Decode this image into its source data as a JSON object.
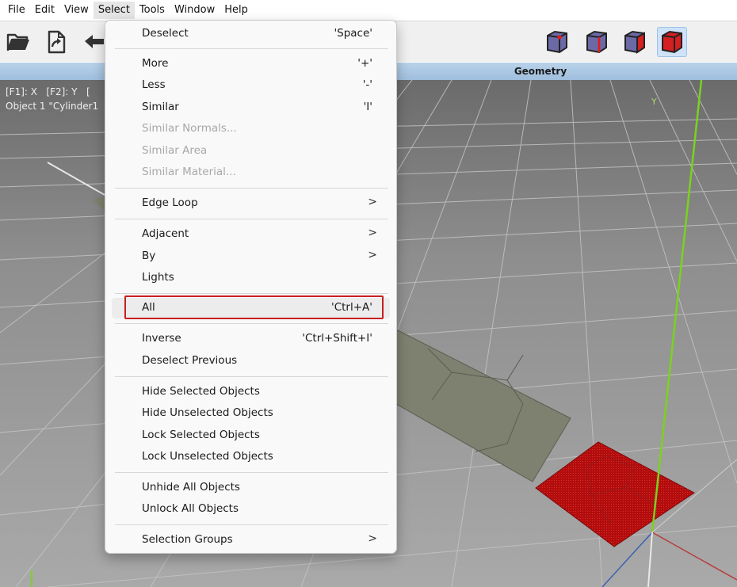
{
  "menubar": {
    "items": [
      {
        "label": "File"
      },
      {
        "label": "Edit"
      },
      {
        "label": "View"
      },
      {
        "label": "Select",
        "active": true
      },
      {
        "label": "Tools"
      },
      {
        "label": "Window"
      },
      {
        "label": "Help"
      }
    ]
  },
  "toolbar": {
    "left_icons": [
      "open-folder-icon",
      "import-file-icon",
      "undo-arrow-icon"
    ],
    "mode_icons": [
      "vertex-select-mode-icon",
      "edge-select-mode-icon",
      "face-select-mode-icon",
      "body-select-mode-icon"
    ],
    "active_mode": "body-select-mode-icon"
  },
  "geometry_bar": {
    "title": "Geometry"
  },
  "viewport": {
    "info_line1": "[F1]: X   [F2]: Y   [",
    "info_line2": "Object 1 \"Cylinder1",
    "axis_label_y": "Y"
  },
  "select_menu": {
    "deselect": {
      "label": "Deselect",
      "shortcut": "'Space'"
    },
    "more": {
      "label": "More",
      "shortcut": "'+'"
    },
    "less": {
      "label": "Less",
      "shortcut": "'-'"
    },
    "similar": {
      "label": "Similar",
      "shortcut": "'I'"
    },
    "similar_normals": {
      "label": "Similar Normals..."
    },
    "similar_area": {
      "label": "Similar Area"
    },
    "similar_material": {
      "label": "Similar Material..."
    },
    "edge_loop": {
      "label": "Edge Loop",
      "arrow": ">"
    },
    "adjacent": {
      "label": "Adjacent",
      "arrow": ">"
    },
    "by": {
      "label": "By",
      "arrow": ">"
    },
    "lights": {
      "label": "Lights"
    },
    "all": {
      "label": "All",
      "shortcut": "'Ctrl+A'"
    },
    "inverse": {
      "label": "Inverse",
      "shortcut": "'Ctrl+Shift+I'"
    },
    "deselect_previous": {
      "label": "Deselect Previous"
    },
    "hide_selected": {
      "label": "Hide Selected Objects"
    },
    "hide_unselected": {
      "label": "Hide Unselected Objects"
    },
    "lock_selected": {
      "label": "Lock Selected Objects"
    },
    "lock_unselected": {
      "label": "Lock Unselected Objects"
    },
    "unhide_all": {
      "label": "Unhide All Objects"
    },
    "unlock_all": {
      "label": "Unlock All Objects"
    },
    "selection_groups": {
      "label": "Selection Groups",
      "arrow": ">"
    }
  },
  "colors": {
    "highlight_box": "#c8201f",
    "selected_face": "#b40e0e",
    "unselected_face": "#7e8070",
    "y_axis": "#7ad21f"
  }
}
